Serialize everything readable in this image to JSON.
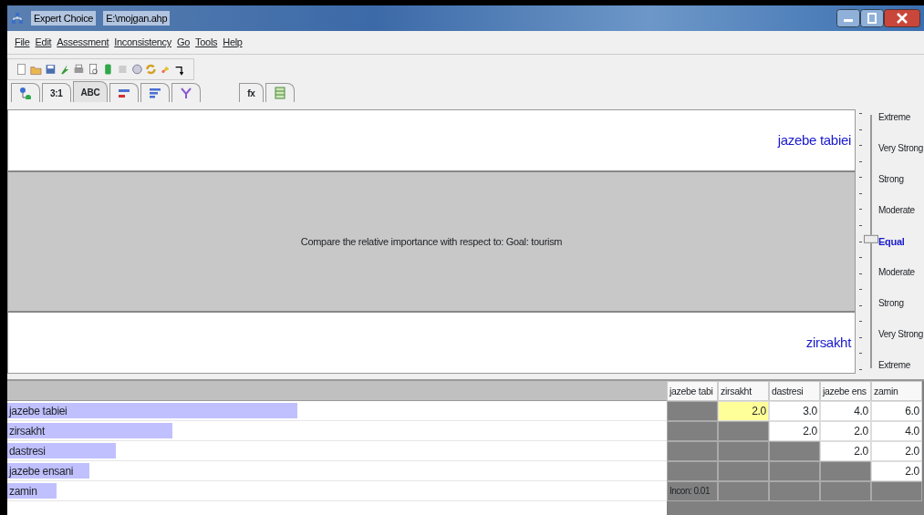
{
  "window": {
    "app": "Expert Choice",
    "file": "E:\\mojgan.ahp"
  },
  "menu": [
    "File",
    "Edit",
    "Assessment",
    "Inconsistency",
    "Go",
    "Tools",
    "Help"
  ],
  "tabs": [
    {
      "kind": "icon",
      "selected": false
    },
    {
      "kind": "text",
      "label": "3:1",
      "selected": false
    },
    {
      "kind": "text",
      "label": "ABC",
      "selected": true
    },
    {
      "kind": "icon",
      "selected": false
    },
    {
      "kind": "icon",
      "selected": false
    },
    {
      "kind": "icon",
      "selected": false
    },
    {
      "kind": "text",
      "label": "fx",
      "selected": false
    },
    {
      "kind": "icon",
      "selected": false
    }
  ],
  "comparison": {
    "top": "jazebe tabiei",
    "prompt": "Compare the relative importance with respect to: Goal: tourism",
    "bottom": "zirsakht",
    "scale": {
      "level": 0.5,
      "labels": [
        {
          "label": "Extreme",
          "selected": false
        },
        {
          "label": "Very Strong",
          "selected": false
        },
        {
          "label": "Strong",
          "selected": false
        },
        {
          "label": "Moderate",
          "selected": false
        },
        {
          "label": "Equal",
          "selected": true
        },
        {
          "label": "Moderate",
          "selected": false
        },
        {
          "label": "Strong",
          "selected": false
        },
        {
          "label": "Very Strong",
          "selected": false
        },
        {
          "label": "Extreme",
          "selected": false
        }
      ]
    }
  },
  "matrix": {
    "columns": [
      "jazebe tabi",
      "zirsakht",
      "dastresi",
      "jazebe ens",
      "zamin"
    ],
    "rows": [
      {
        "name": "jazebe tabiei",
        "level": 0.44,
        "cells": [
          {
            "kind": "blank"
          },
          {
            "kind": "value",
            "text": "2.0",
            "selected": true
          },
          {
            "kind": "value",
            "text": "3.0",
            "selected": false
          },
          {
            "kind": "value",
            "text": "4.0",
            "selected": false
          },
          {
            "kind": "value",
            "text": "6.0",
            "selected": false
          }
        ]
      },
      {
        "name": "zirsakht",
        "level": 0.25,
        "cells": [
          {
            "kind": "blank"
          },
          {
            "kind": "blank"
          },
          {
            "kind": "value",
            "text": "2.0",
            "selected": false
          },
          {
            "kind": "value",
            "text": "2.0",
            "selected": false
          },
          {
            "kind": "value",
            "text": "4.0",
            "selected": false
          }
        ]
      },
      {
        "name": "dastresi",
        "level": 0.165,
        "cells": [
          {
            "kind": "blank"
          },
          {
            "kind": "blank"
          },
          {
            "kind": "blank"
          },
          {
            "kind": "value",
            "text": "2.0",
            "selected": false
          },
          {
            "kind": "value",
            "text": "2.0",
            "selected": false
          }
        ]
      },
      {
        "name": "jazebe ensani",
        "level": 0.125,
        "cells": [
          {
            "kind": "blank"
          },
          {
            "kind": "blank"
          },
          {
            "kind": "blank"
          },
          {
            "kind": "blank"
          },
          {
            "kind": "value",
            "text": "2.0",
            "selected": false
          }
        ]
      },
      {
        "name": "zamin",
        "level": 0.075,
        "cells": [
          {
            "kind": "note",
            "text": "Incon: 0.01"
          },
          {
            "kind": "blank"
          },
          {
            "kind": "blank"
          },
          {
            "kind": "blank"
          },
          {
            "kind": "blank"
          }
        ]
      }
    ]
  }
}
